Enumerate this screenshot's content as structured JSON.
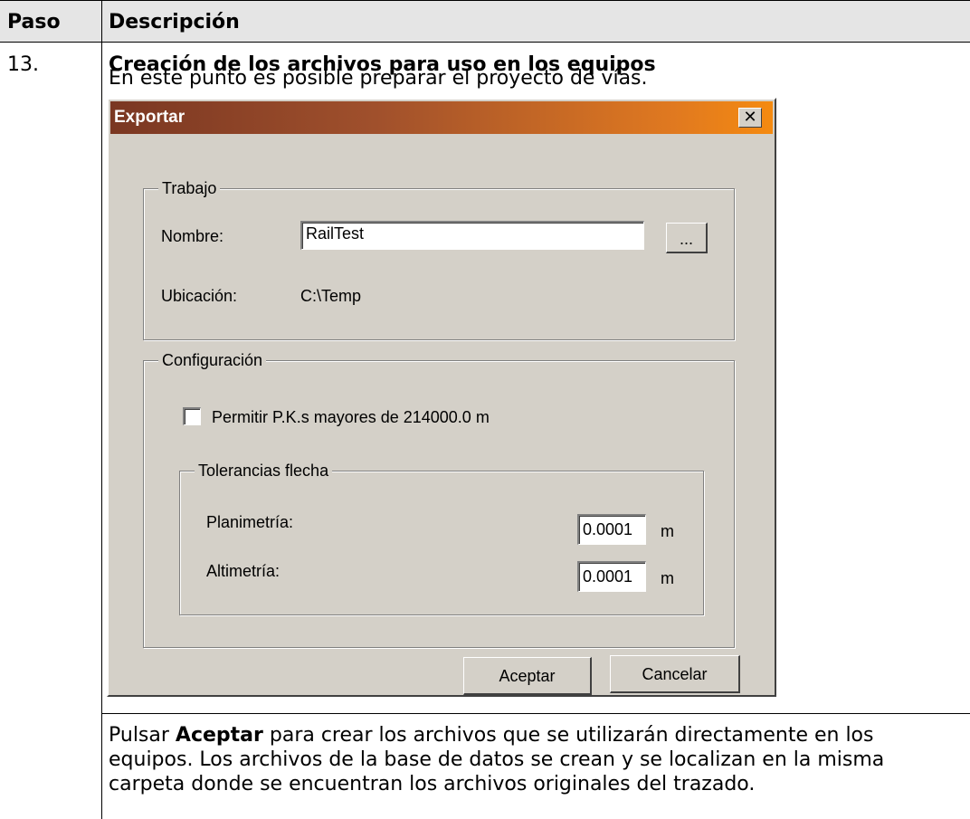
{
  "table": {
    "header": {
      "step": "Paso",
      "description": "Descripción"
    },
    "step_number": "13.",
    "heading": "Creación de los archivos para uso en los equipos",
    "intro": "En este punto es posible preparar el proyecto de vías.",
    "footer": {
      "prefix": "Pulsar ",
      "bold": "Aceptar",
      "line1_rest": " para crear los archivos que se utilizarán directamente en los",
      "line2": "equipos. Los archivos de la base de datos se crean y se localizan en la misma",
      "line3": "carpeta donde se encuentran los archivos originales del trazado."
    }
  },
  "dialog": {
    "title": "Exportar",
    "close_glyph": "✕",
    "trabajo": {
      "legend": "Trabajo",
      "name_label": "Nombre:",
      "name_value": "RailTest",
      "browse_label": "...",
      "location_label": "Ubicación:",
      "location_value": "C:\\Temp"
    },
    "configuracion": {
      "legend": "Configuración",
      "allow_label": "Permitir P.K.s mayores de 214000.0 m",
      "allow_checked": false,
      "tolerances": {
        "legend": "Tolerancias flecha",
        "plan_label": "Planimetría:",
        "plan_value": "0.0001",
        "plan_unit": "m",
        "alt_label": "Altimetría:",
        "alt_value": "0.0001",
        "alt_unit": "m"
      }
    },
    "ok_label": "Aceptar",
    "cancel_label": "Cancelar"
  }
}
